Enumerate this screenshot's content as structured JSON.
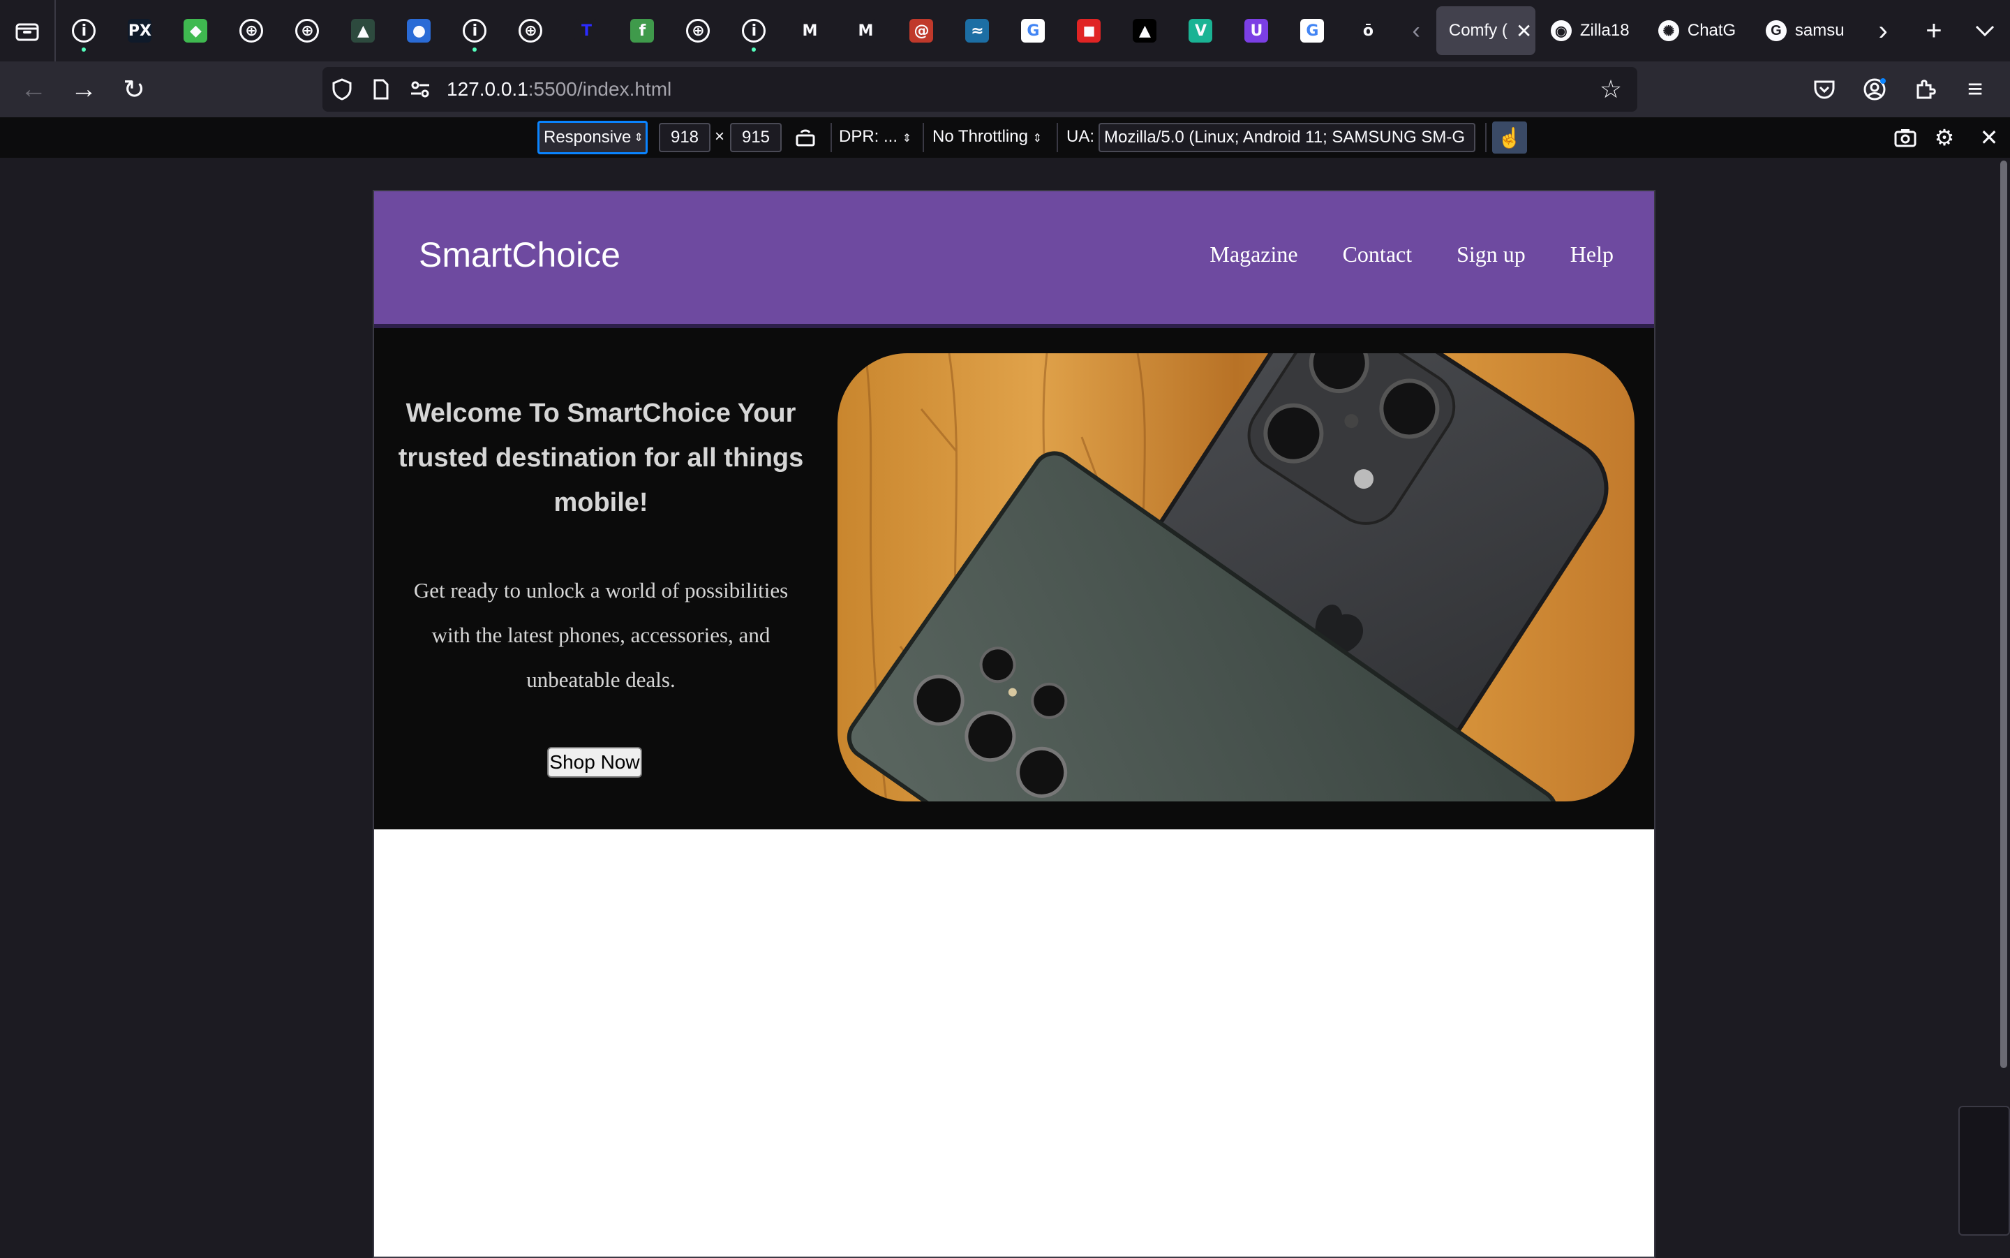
{
  "browser": {
    "pinned_tabs": [
      {
        "icon": "info-icon",
        "glyph": "i",
        "color": "#42414d",
        "dot": true
      },
      {
        "icon": "pixel-app-icon",
        "glyph": "PX",
        "color": "#0f1a2a",
        "dot": false
      },
      {
        "icon": "frog-icon",
        "glyph": "◆",
        "color": "#3fb950",
        "dot": false
      },
      {
        "icon": "globe-icon",
        "glyph": "⊕",
        "color": "#42414d",
        "dot": false
      },
      {
        "icon": "globe-icon",
        "glyph": "⊕",
        "color": "#42414d",
        "dot": false
      },
      {
        "icon": "app-icon",
        "glyph": "▲",
        "color": "#2d4a3e",
        "dot": false
      },
      {
        "icon": "moon-icon",
        "glyph": "●",
        "color": "#2a6bd6",
        "dot": false
      },
      {
        "icon": "info-icon",
        "glyph": "i",
        "color": "#42414d",
        "dot": true
      },
      {
        "icon": "globe-icon",
        "glyph": "⊕",
        "color": "#42414d",
        "dot": false
      },
      {
        "icon": "t-letter-icon",
        "glyph": "T",
        "color": "#1c1b22",
        "dot": false
      },
      {
        "icon": "leaf-icon",
        "glyph": "f",
        "color": "#3f9a4b",
        "dot": false
      },
      {
        "icon": "globe-icon",
        "glyph": "⊕",
        "color": "#42414d",
        "dot": false
      },
      {
        "icon": "info-icon",
        "glyph": "i",
        "color": "#42414d",
        "dot": true
      },
      {
        "icon": "m-letter-icon",
        "glyph": "M",
        "color": "#1c1b22",
        "dot": false
      },
      {
        "icon": "m-letter-icon",
        "glyph": "M",
        "color": "#1c1b22",
        "dot": false
      },
      {
        "icon": "swirl-icon",
        "glyph": "@",
        "color": "#c0392b",
        "dot": false
      },
      {
        "icon": "wave-icon",
        "glyph": "≈",
        "color": "#1c6ea4",
        "dot": false
      },
      {
        "icon": "google-icon",
        "glyph": "G",
        "color": "#ffffff",
        "dot": false
      },
      {
        "icon": "red-app-icon",
        "glyph": "◼",
        "color": "#e02424",
        "dot": false
      },
      {
        "icon": "triangle-icon",
        "glyph": "▲",
        "color": "#000000",
        "dot": false
      },
      {
        "icon": "v-logo-icon",
        "glyph": "V",
        "color": "#1ab394",
        "dot": false
      },
      {
        "icon": "shield-u-icon",
        "glyph": "U",
        "color": "#7b3fe4",
        "dot": false
      },
      {
        "icon": "google-icon",
        "glyph": "G",
        "color": "#ffffff",
        "dot": false
      },
      {
        "icon": "o-letter-icon",
        "glyph": "ō",
        "color": "#1c1b22",
        "dot": false
      }
    ],
    "tabs": [
      {
        "label": "Comfy (",
        "icon": "",
        "active": true
      },
      {
        "label": "Zilla18",
        "icon": "github-icon",
        "active": false
      },
      {
        "label": "ChatG",
        "icon": "openai-icon",
        "active": false
      },
      {
        "label": "samsu",
        "icon": "google-icon",
        "active": false
      }
    ],
    "url_host": "127.0.0.1",
    "url_rest": ":5500/index.html"
  },
  "rdm": {
    "device": "Responsive",
    "width": "918",
    "height": "915",
    "times": "×",
    "dpr": "DPR: ...",
    "throttling": "No Throttling",
    "ua_label": "UA:",
    "ua_value": "Mozilla/5.0 (Linux; Android 11; SAMSUNG SM-G"
  },
  "site": {
    "logo": "SmartChoice",
    "nav": [
      "Magazine",
      "Contact",
      "Sign up",
      "Help"
    ],
    "hero_title": "Welcome To SmartChoice Your trusted destination for all things mobile!",
    "hero_subtitle": "Get ready to unlock a world of possibilities with the latest phones, accessories, and unbeatable deals.",
    "cta": "Shop Now"
  }
}
